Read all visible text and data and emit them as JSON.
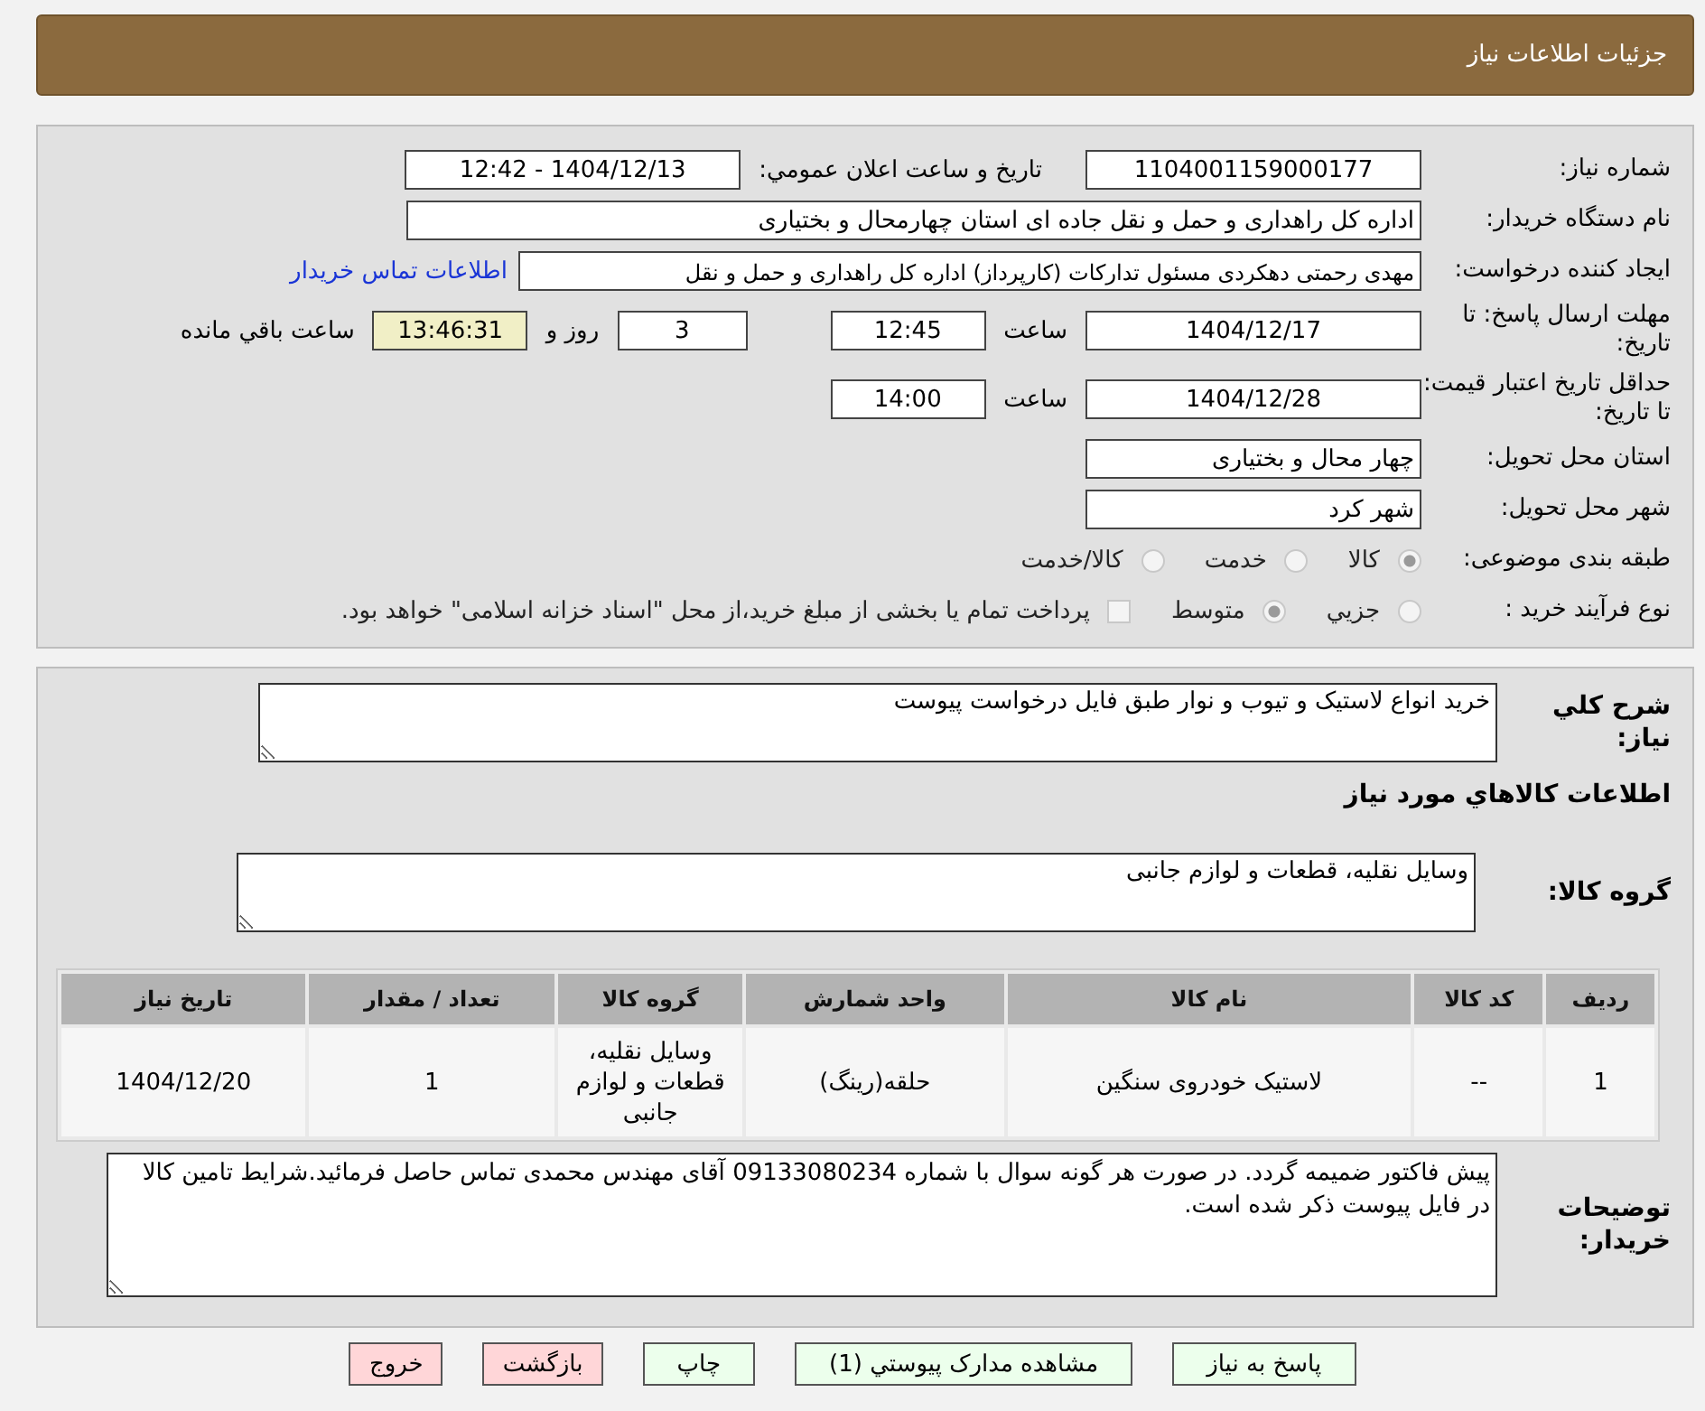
{
  "header": {
    "title": "جزئیات اطلاعات نیاز"
  },
  "need_number": {
    "label": "شماره نیاز:",
    "value": "1104001159000177"
  },
  "announce": {
    "label": "تاريخ و ساعت اعلان عمومي:",
    "value": "1404/12/13 - 12:42"
  },
  "buyer_org": {
    "label": "نام دستگاه خريدار:",
    "value": "اداره کل راهداری و حمل و نقل جاده ای استان چهارمحال و بختیاری"
  },
  "requester": {
    "label": "ایجاد کننده درخواست:",
    "value": "مهدی رحمتی دهکردی مسئول تدارکات (کارپرداز) اداره کل راهداری و حمل و نقل",
    "link": "اطلاعات تماس خریدار"
  },
  "deadline": {
    "label": "مهلت ارسال پاسخ: تا تاریخ:",
    "date": "1404/12/17",
    "time_label": "ساعت",
    "time": "12:45",
    "days": "3",
    "days_label": "روز و",
    "remaining": "13:46:31",
    "remaining_label": "ساعت باقي مانده"
  },
  "validity": {
    "label": "حداقل تاریخ اعتبار قیمت: تا تاریخ:",
    "date": "1404/12/28",
    "time_label": "ساعت",
    "time": "14:00"
  },
  "province": {
    "label": "استان محل تحویل:",
    "value": "چهار محال و بختیاری"
  },
  "city": {
    "label": "شهر محل تحویل:",
    "value": "شهر کرد"
  },
  "category": {
    "label": "طبقه بندی موضوعی:",
    "options": [
      {
        "label": "کالا",
        "selected": true
      },
      {
        "label": "خدمت",
        "selected": false
      },
      {
        "label": "کالا/خدمت",
        "selected": false
      }
    ]
  },
  "process": {
    "label": "نوع فرآیند خرید :",
    "options": [
      {
        "label": "جزيي",
        "selected": false
      },
      {
        "label": "متوسط",
        "selected": true
      }
    ],
    "payment": {
      "label": "پرداخت تمام یا بخشی از مبلغ خرید،از محل \"اسناد خزانه اسلامی\" خواهد بود.",
      "checked": false
    }
  },
  "description": {
    "label": "شرح کلي نياز:",
    "value": "خرید انواع لاستیک و تیوب و نوار طبق فایل درخواست پیوست"
  },
  "goods_title": "اطلاعات کالاهاي مورد نياز",
  "goods_group": {
    "label": "گروه کالا:",
    "value": "وسایل نقلیه، قطعات و لوازم جانبی"
  },
  "table": {
    "columns": [
      "رديف",
      "کد کالا",
      "نام کالا",
      "واحد شمارش",
      "گروه کالا",
      "تعداد / مقدار",
      "تاريخ نياز"
    ],
    "rows": [
      [
        "1",
        "--",
        "لاستیک خودروی سنگین",
        "حلقه(رینگ)",
        "وسایل نقلیه، قطعات و لوازم جانبی",
        "1",
        "1404/12/20"
      ]
    ]
  },
  "notes": {
    "label": "توضيحات خريدار:",
    "value": "پیش فاکتور ضمیمه گردد. در صورت هر گونه سوال با شماره 09133080234 آقای مهندس محمدی تماس حاصل فرمائید.شرایط تامین کالا در فایل پیوست ذکر شده است."
  },
  "buttons": [
    {
      "label": "پاسخ به نیاز",
      "kind": "green"
    },
    {
      "label": "مشاهده مدارک پیوستي (1)",
      "kind": "green"
    },
    {
      "label": "چاپ",
      "kind": "green"
    },
    {
      "label": "بازگشت",
      "kind": "red"
    },
    {
      "label": "خروج",
      "kind": "red"
    }
  ]
}
